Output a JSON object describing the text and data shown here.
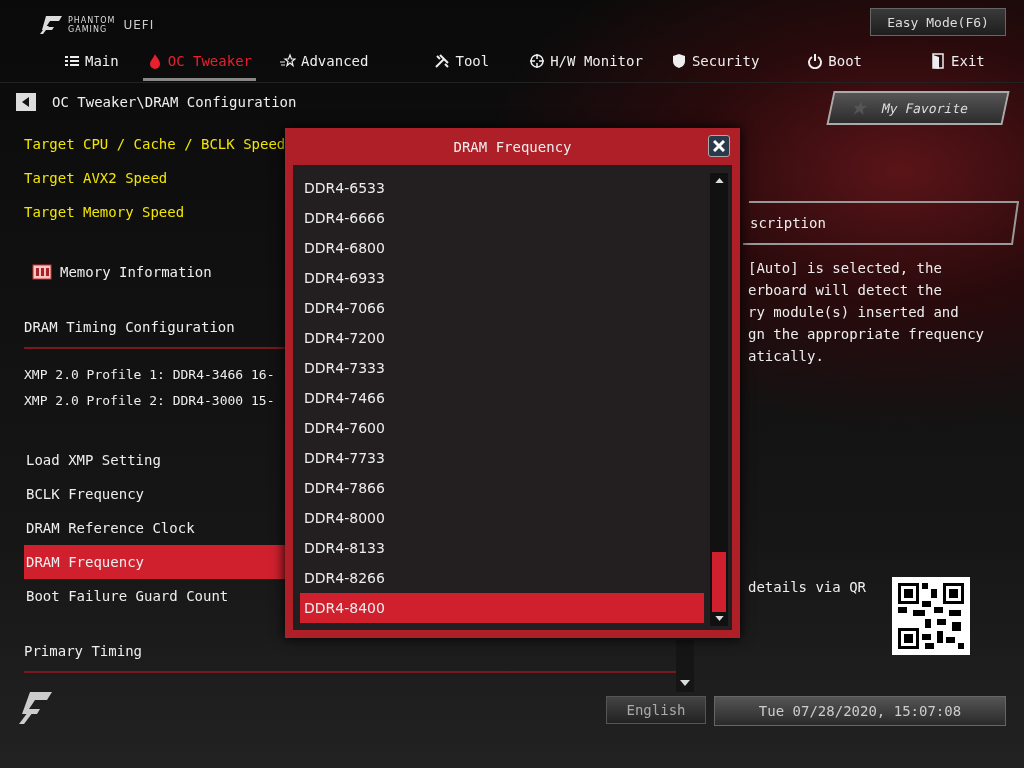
{
  "header": {
    "logo_line1": "PHANTOM",
    "logo_line2": "GAMING",
    "logo_suffix": "UEFI",
    "easy_mode_button": "Easy Mode(F6)"
  },
  "tabs": [
    {
      "label": "Main",
      "selected": false
    },
    {
      "label": "OC Tweaker",
      "selected": true
    },
    {
      "label": "Advanced",
      "selected": false
    },
    {
      "label": "Tool",
      "selected": false
    },
    {
      "label": "H/W Monitor",
      "selected": false
    },
    {
      "label": "Security",
      "selected": false
    },
    {
      "label": "Boot",
      "selected": false
    },
    {
      "label": "Exit",
      "selected": false
    }
  ],
  "breadcrumb": "OC Tweaker\\DRAM Configuration",
  "favorite_button": "My Favorite",
  "items": [
    {
      "kind": "target",
      "label": "Target CPU / Cache / BCLK Speed"
    },
    {
      "kind": "target",
      "label": "Target AVX2 Speed"
    },
    {
      "kind": "target",
      "label": "Target Memory Speed"
    },
    {
      "kind": "link",
      "label": "Memory Information"
    },
    {
      "kind": "header",
      "label": "DRAM Timing Configuration"
    },
    {
      "kind": "info",
      "label": "XMP 2.0 Profile 1: DDR4-3466 16-"
    },
    {
      "kind": "info",
      "label": "XMP 2.0 Profile 2: DDR4-3000 15-"
    },
    {
      "kind": "setting",
      "label": "Load XMP Setting",
      "selected": false
    },
    {
      "kind": "setting",
      "label": "BCLK Frequency",
      "selected": false
    },
    {
      "kind": "setting",
      "label": "DRAM Reference Clock",
      "selected": false
    },
    {
      "kind": "setting",
      "label": "DRAM Frequency",
      "selected": true
    },
    {
      "kind": "setting",
      "label": "Boot Failure Guard Count",
      "selected": false
    },
    {
      "kind": "header",
      "label": "Primary Timing"
    }
  ],
  "description": {
    "title": "scription",
    "lines": [
      "[Auto] is selected, the",
      "erboard will detect the",
      "ry module(s) inserted and",
      "gn the appropriate frequency",
      "atically."
    ],
    "qr_text": "details via QR"
  },
  "dialog": {
    "title": "DRAM Frequency",
    "options": [
      {
        "label": "DDR4-6533",
        "selected": false
      },
      {
        "label": "DDR4-6666",
        "selected": false
      },
      {
        "label": "DDR4-6800",
        "selected": false
      },
      {
        "label": "DDR4-6933",
        "selected": false
      },
      {
        "label": "DDR4-7066",
        "selected": false
      },
      {
        "label": "DDR4-7200",
        "selected": false
      },
      {
        "label": "DDR4-7333",
        "selected": false
      },
      {
        "label": "DDR4-7466",
        "selected": false
      },
      {
        "label": "DDR4-7600",
        "selected": false
      },
      {
        "label": "DDR4-7733",
        "selected": false
      },
      {
        "label": "DDR4-7866",
        "selected": false
      },
      {
        "label": "DDR4-8000",
        "selected": false
      },
      {
        "label": "DDR4-8133",
        "selected": false
      },
      {
        "label": "DDR4-8266",
        "selected": false
      },
      {
        "label": "DDR4-8400",
        "selected": true
      }
    ]
  },
  "footer": {
    "language": "English",
    "datetime": "Tue 07/28/2020, 15:07:08"
  }
}
